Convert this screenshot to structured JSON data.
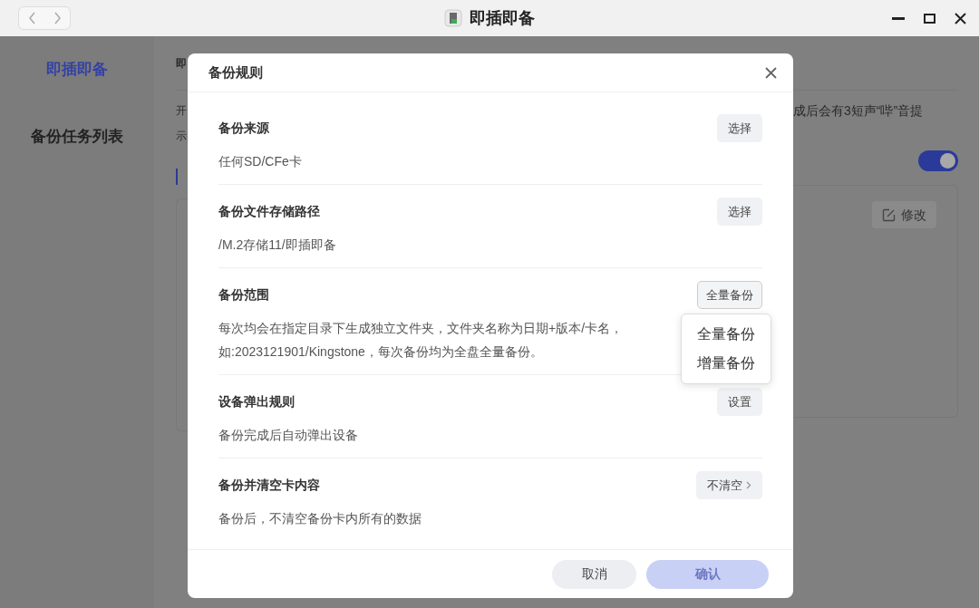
{
  "window": {
    "title": "即插即备"
  },
  "sidebar": {
    "items": [
      {
        "label": "即插即备",
        "selected": true
      },
      {
        "label": "备份任务列表",
        "selected": false
      }
    ]
  },
  "background": {
    "tab_fragment": "即",
    "intro_fragments": [
      "开",
      "示"
    ],
    "intro_right_fragment": "成后会有3短声“哔”音提",
    "toggle": {
      "on": true
    },
    "edit_button": "修改"
  },
  "dialog": {
    "title": "备份规则",
    "sections": [
      {
        "title": "备份来源",
        "description": "任何SD/CFe卡",
        "button": {
          "label": "选择",
          "kind": "plain"
        }
      },
      {
        "title": "备份文件存储路径",
        "description": "/M.2存储11/即插即备",
        "button": {
          "label": "选择",
          "kind": "plain"
        }
      },
      {
        "title": "备份范围",
        "description": "每次均会在指定目录下生成独立文件夹，文件夹名称为日期+版本/卡名，如:2023121901/Kingstone，每次备份均为全盘全量备份。",
        "button": {
          "label": "全量备份",
          "kind": "select",
          "menu_open": true,
          "options": [
            {
              "label": "全量备份"
            },
            {
              "label": "增量备份"
            }
          ]
        }
      },
      {
        "title": "设备弹出规则",
        "description": "备份完成后自动弹出设备",
        "button": {
          "label": "设置",
          "kind": "plain"
        }
      },
      {
        "title": "备份并清空卡内容",
        "description": "备份后，不清空备份卡内所有的数据",
        "button": {
          "label": "不清空",
          "kind": "chevron"
        }
      }
    ],
    "buttons": [
      {
        "label": "取消",
        "kind": "secondary",
        "disabled": false
      },
      {
        "label": "确认",
        "kind": "primary",
        "disabled": true
      }
    ]
  }
}
